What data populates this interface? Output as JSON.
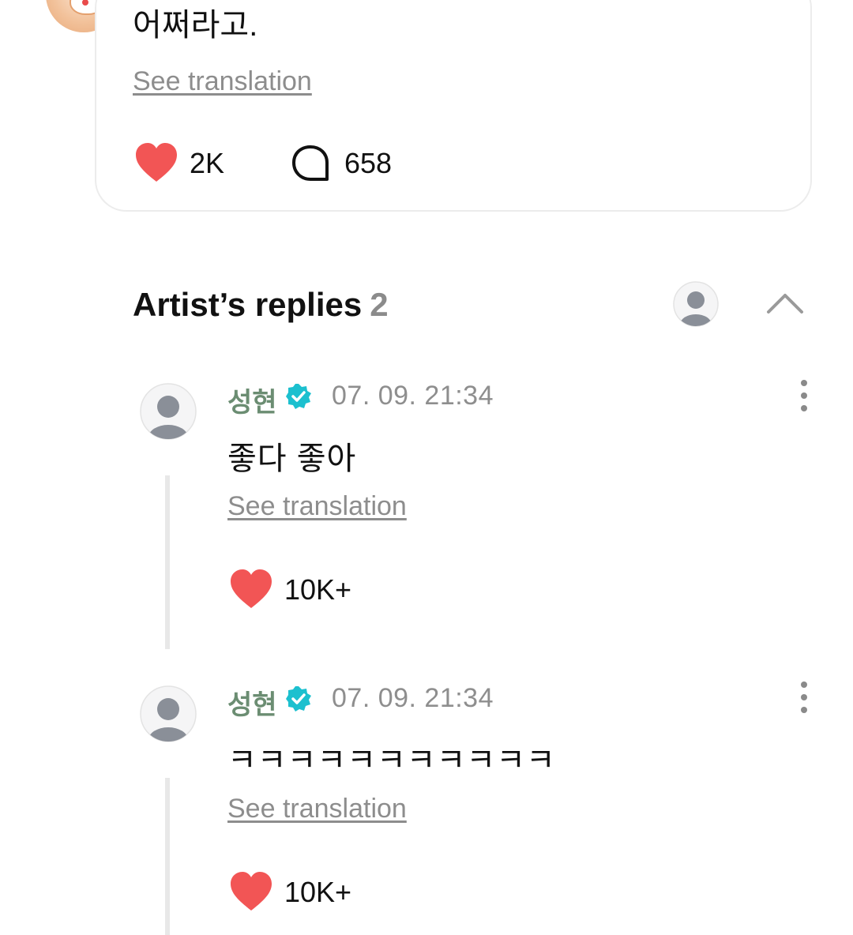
{
  "post": {
    "text": "어쩌라고.",
    "see_translation": "See translation",
    "likes": "2K",
    "comments": "658"
  },
  "artist_replies": {
    "title": "Artist’s replies",
    "count": "2",
    "replies": [
      {
        "name": "성현",
        "time": "07. 09. 21:34",
        "text": "좋다 좋아",
        "see_translation": "See translation",
        "likes": "10K+"
      },
      {
        "name": "성현",
        "time": "07. 09. 21:34",
        "text": "ㅋㅋㅋㅋㅋㅋㅋㅋㅋㅋㅋ",
        "see_translation": "See translation",
        "likes": "10K+"
      }
    ]
  },
  "colors": {
    "like_red": "#f25555",
    "verified_teal": "#1cc0cf",
    "artist_name_green": "#6b8d72",
    "muted_gray": "#8d8d8d"
  },
  "icons": {
    "like": "heart-icon",
    "comment": "comment-bubble-icon",
    "verified": "verified-badge-icon",
    "more": "more-vertical-icon",
    "collapse": "chevron-up-icon",
    "avatar_placeholder": "user-avatar-icon"
  }
}
